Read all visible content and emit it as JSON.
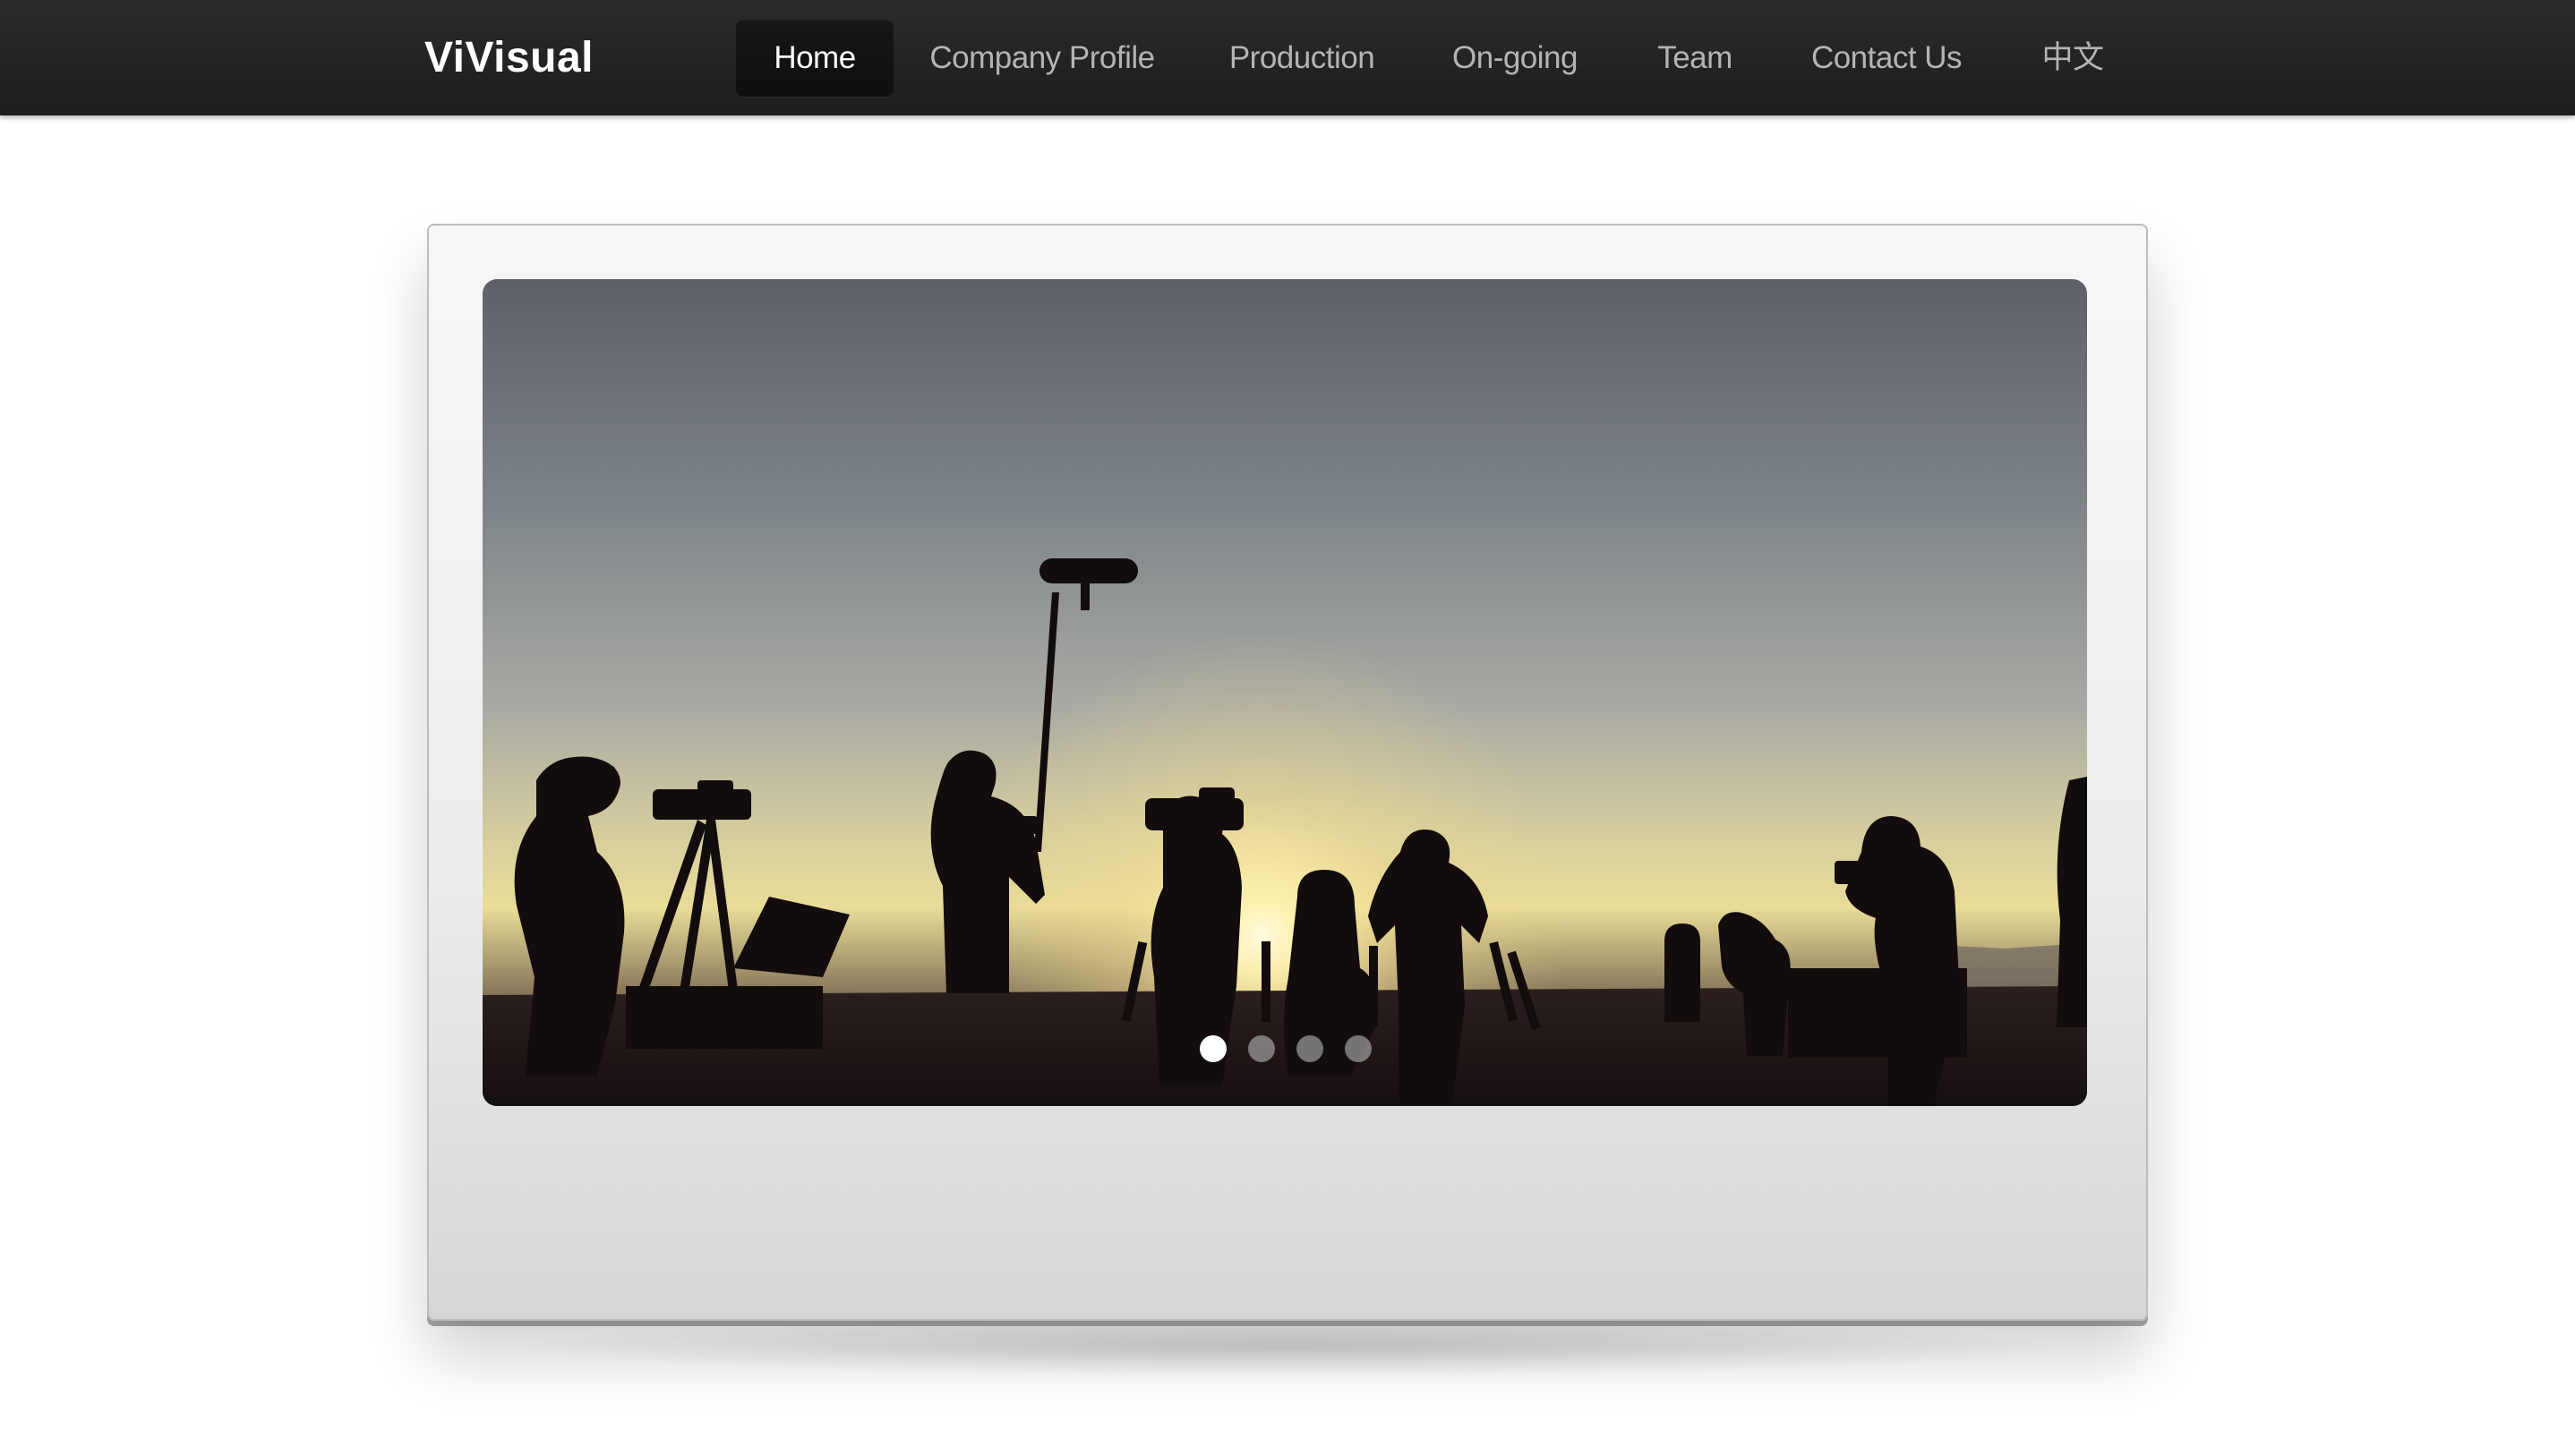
{
  "brand": {
    "name": "ViVisual"
  },
  "nav": {
    "items": [
      {
        "label": "Home",
        "active": true
      },
      {
        "label": "Company Profile",
        "active": false
      },
      {
        "label": "Production",
        "active": false
      },
      {
        "label": "On-going",
        "active": false
      },
      {
        "label": "Team",
        "active": false
      },
      {
        "label": "Contact Us",
        "active": false
      },
      {
        "label": "中文",
        "active": false
      }
    ]
  },
  "slider": {
    "image": "film-crew-silhouette-at-sunset",
    "slide_count": 4,
    "active_slide": 1
  },
  "colors": {
    "nav_bg": "#232323",
    "nav_active_bg": "#121212",
    "nav_text": "#b4b4b4",
    "nav_active_text": "#ffffff"
  }
}
